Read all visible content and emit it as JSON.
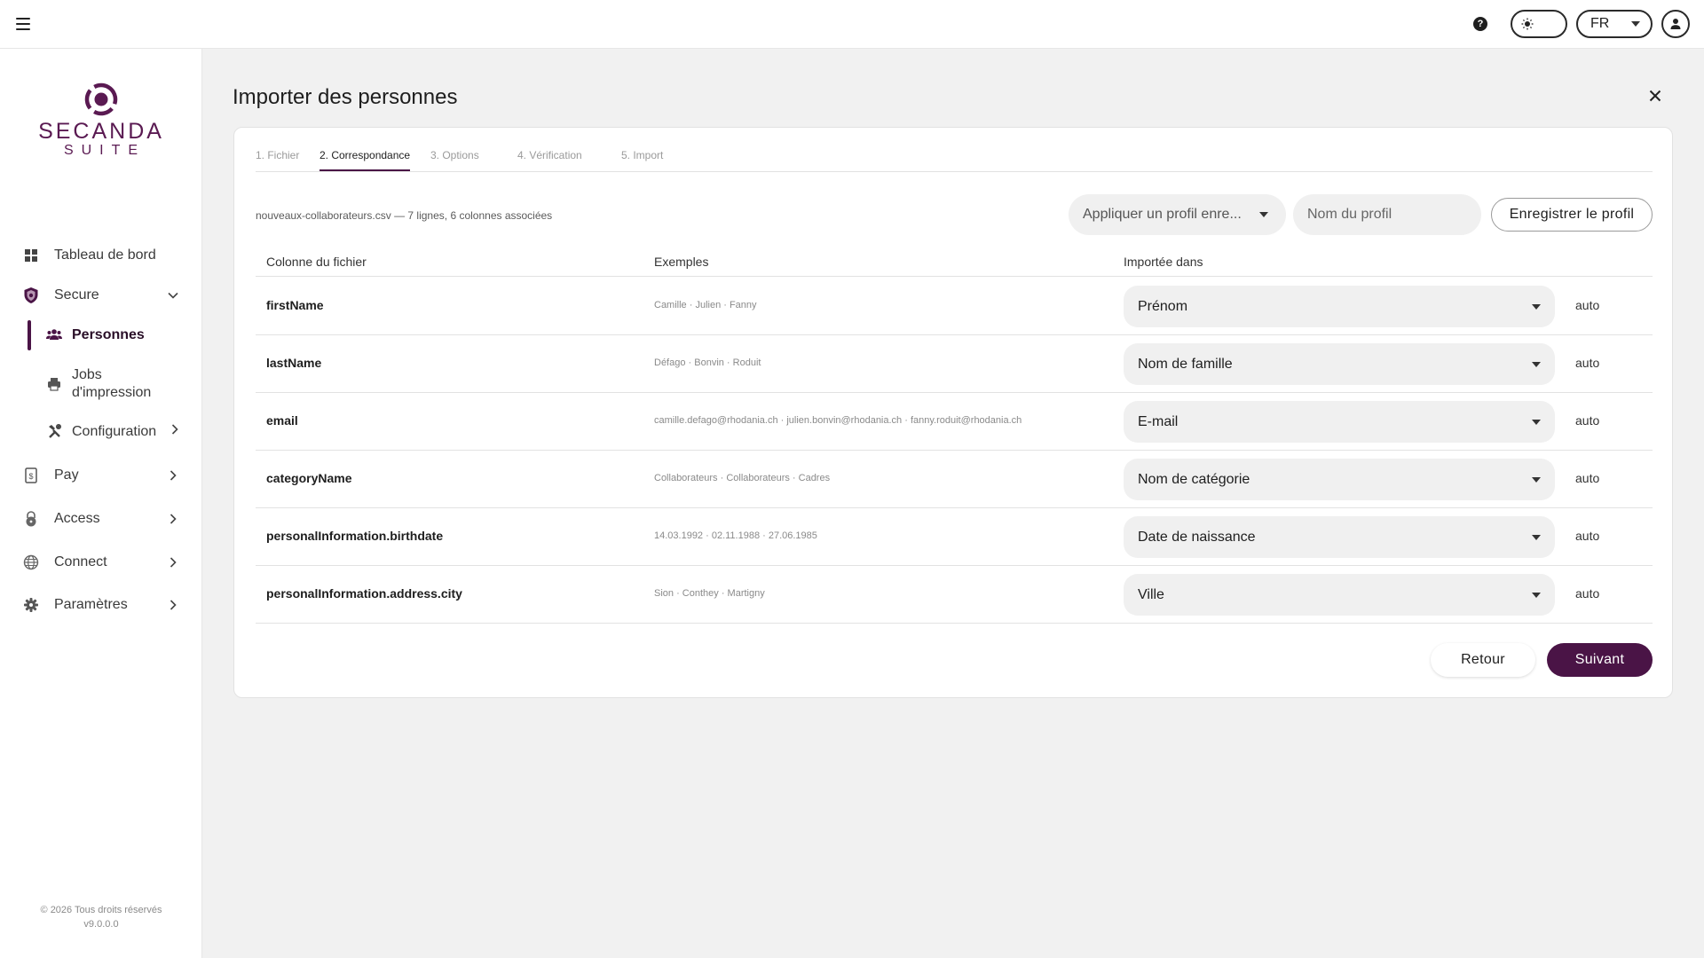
{
  "topbar": {
    "menu_icon": "hamburger-icon",
    "help_label": "?",
    "theme_icon": "sun-icon",
    "language": "FR",
    "user_icon": "user-icon"
  },
  "sidebar": {
    "logo_word": "SECANDA",
    "logo_sub": "SUITE",
    "items": [
      {
        "label": "Tableau de bord",
        "icon": "dashboard-icon"
      },
      {
        "label": "Secure",
        "icon": "shield-icon"
      },
      {
        "label": "Personnes",
        "icon": "people-icon"
      },
      {
        "label": "Jobs d'impression",
        "icon": "printer-icon"
      },
      {
        "label": "Configuration",
        "icon": "tools-icon"
      },
      {
        "label": "Pay",
        "icon": "pay-icon"
      },
      {
        "label": "Access",
        "icon": "lock-icon"
      },
      {
        "label": "Connect",
        "icon": "globe-icon"
      },
      {
        "label": "Paramètres",
        "icon": "gear-icon"
      }
    ],
    "footer_copyright": "© 2026 Tous droits réservés",
    "footer_version": "v9.0.0.0"
  },
  "main": {
    "title": "Importer des personnes",
    "tabs": [
      {
        "label": "1. Fichier"
      },
      {
        "label": "2. Correspondance"
      },
      {
        "label": "3. Options"
      },
      {
        "label": "4. Vérification"
      },
      {
        "label": "5. Import"
      }
    ],
    "active_tab": 1,
    "file_info": "nouveaux-collaborateurs.csv — 7 lignes, 6 colonnes associées",
    "profile_select": "Appliquer un profil enre...",
    "profile_name_placeholder": "Nom du profil",
    "save_profile": "Enregistrer le profil",
    "columns": {
      "file_column": "Colonne du fichier",
      "examples": "Exemples",
      "imported_into": "Importée dans"
    },
    "rows": [
      {
        "name": "firstName",
        "examples": "Camille · Julien · Fanny",
        "target": "Prénom",
        "mode": "auto"
      },
      {
        "name": "lastName",
        "examples": "Défago · Bonvin · Roduit",
        "target": "Nom de famille",
        "mode": "auto"
      },
      {
        "name": "email",
        "examples": "camille.defago@rhodania.ch · julien.bonvin@rhodania.ch · fanny.roduit@rhodania.ch",
        "target": "E-mail",
        "mode": "auto"
      },
      {
        "name": "categoryName",
        "examples": "Collaborateurs · Collaborateurs · Cadres",
        "target": "Nom de catégorie",
        "mode": "auto"
      },
      {
        "name": "personalInformation.birthdate",
        "examples": "14.03.1992 · 02.11.1988 · 27.06.1985",
        "target": "Date de naissance",
        "mode": "auto"
      },
      {
        "name": "personalInformation.address.city",
        "examples": "Sion · Conthey · Martigny",
        "target": "Ville",
        "mode": "auto"
      }
    ],
    "back_label": "Retour",
    "next_label": "Suivant"
  },
  "colors": {
    "accent": "#4a1446",
    "logo": "#5a1a52",
    "background": "#f1f1f1"
  }
}
